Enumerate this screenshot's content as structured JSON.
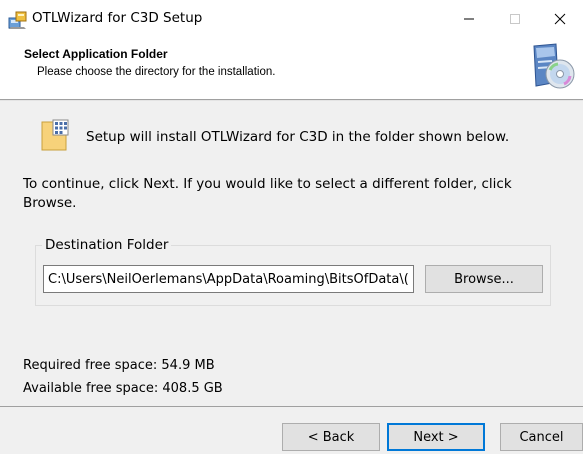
{
  "window": {
    "title": "OTLWizard for C3D Setup",
    "icons": {
      "app": "setup-installer-icon",
      "minimize": "minimize-icon",
      "maximize": "maximize-icon",
      "close": "close-icon"
    }
  },
  "header": {
    "title": "Select Application Folder",
    "subtitle": "Please choose the directory for the installation.",
    "icon": "cd-installer-icon"
  },
  "body": {
    "intro": "Setup will install OTLWizard for C3D in the folder shown below.",
    "instruction_line1": "To continue, click Next. If you would like to select a different folder, click",
    "instruction_line2": "Browse.",
    "folder_icon": "folder-icon",
    "destination": {
      "legend": "Destination Folder",
      "path_value": "C:\\Users\\NeilOerlemans\\AppData\\Roaming\\BitsOfData\\(",
      "browse_label": "Browse..."
    },
    "required_space": "Required free space: 54.9 MB",
    "available_space": "Available free space: 408.5 GB"
  },
  "footer": {
    "back_label": "< Back",
    "next_label": "Next >",
    "cancel_label": "Cancel"
  },
  "colors": {
    "accent": "#0078d7",
    "panel_background": "#f0f0f0",
    "button_face": "#e1e1e1"
  }
}
